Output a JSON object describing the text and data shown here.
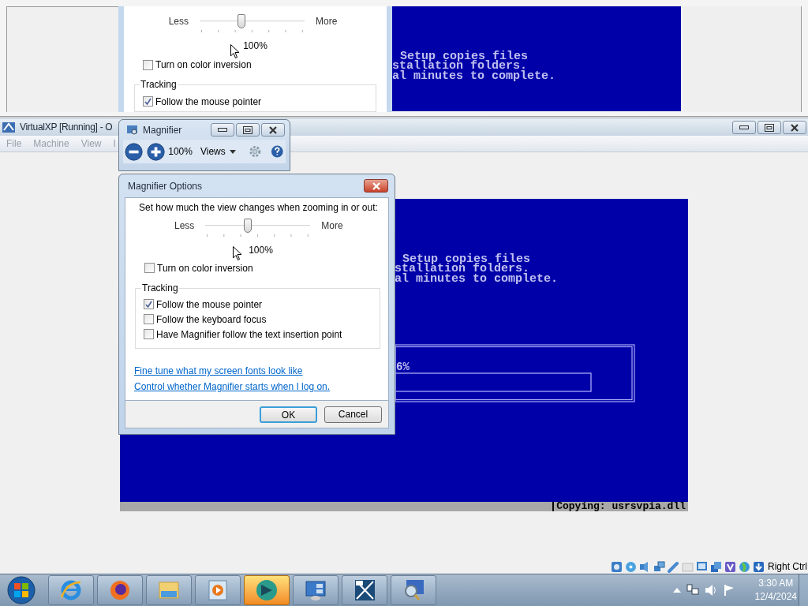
{
  "magnified_view": {
    "slider_labels": [
      "Less",
      "More"
    ],
    "slider": {
      "level": 0.4
    },
    "zoom_value": "100%",
    "color_inversion": {
      "label": "Turn on color inversion",
      "checked": false
    },
    "tracking_title": "Tracking",
    "tracking_option": {
      "label": "Follow the mouse pointer",
      "checked": true
    },
    "console_lines": [
      "Setup copies files",
      "stallation folders.",
      "al minutes to complete."
    ]
  },
  "vm_window": {
    "title": "VirtualXP [Running] - O",
    "menu": [
      "File",
      "Machine",
      "View",
      "I"
    ],
    "console_lines": [
      "Setup copies files",
      "stallation folders.",
      "al minutes to complete."
    ],
    "progress_label": "6%",
    "status_line": "Copying: usrsvpia.dll",
    "host_key": "Right Ctrl"
  },
  "magnifier": {
    "title": "Magnifier",
    "zoom": "100%",
    "views": "Views"
  },
  "options_dialog": {
    "title": "Magnifier Options",
    "prompt": "Set how much the view changes when zooming in or out:",
    "slider_labels": [
      "Less",
      "More"
    ],
    "slider": {
      "level": 0.4
    },
    "zoom_value": "100%",
    "color_inversion": {
      "label": "Turn on color inversion",
      "checked": false
    },
    "tracking": {
      "title": "Tracking",
      "options": [
        {
          "label": "Follow the mouse pointer",
          "checked": true
        },
        {
          "label": "Follow the keyboard focus",
          "checked": false
        },
        {
          "label": "Have Magnifier follow the text insertion point",
          "checked": false
        }
      ]
    },
    "links": [
      "Fine tune what my screen fonts look like",
      "Control whether Magnifier starts when I log on."
    ],
    "buttons": [
      {
        "label": "OK",
        "default": true
      },
      {
        "label": "Cancel",
        "default": false
      }
    ]
  },
  "taskbar": {
    "apps": [
      {
        "kind": "ie",
        "selected": false
      },
      {
        "kind": "firefox",
        "selected": false
      },
      {
        "kind": "explorer",
        "selected": false
      },
      {
        "kind": "media",
        "selected": false
      },
      {
        "kind": "disc",
        "selected": true
      },
      {
        "kind": "gadgets",
        "selected": false
      },
      {
        "kind": "xp",
        "selected": false
      },
      {
        "kind": "magnifier",
        "selected": false
      }
    ],
    "clock": {
      "time": "3:30 AM",
      "date": "12/4/2024"
    }
  }
}
